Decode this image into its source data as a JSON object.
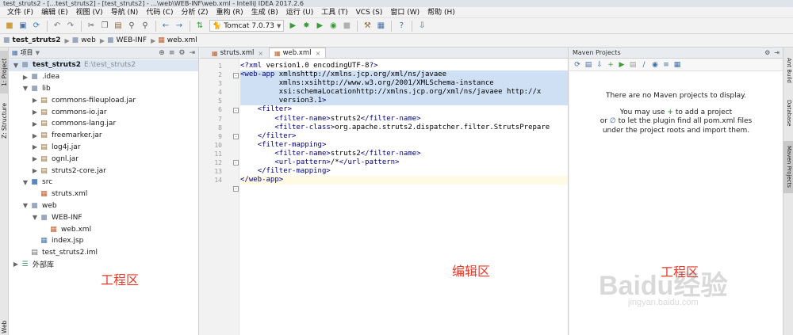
{
  "window": {
    "title": "test_struts2 - [...test_struts2] - [test_struts2] - ...\\web\\WEB-INF\\web.xml - IntelliJ IDEA 2017.2.6"
  },
  "menu": [
    "文件 (F)",
    "编辑 (E)",
    "视图 (V)",
    "导航 (N)",
    "代码 (C)",
    "分析 (Z)",
    "重构 (R)",
    "生成 (B)",
    "运行 (U)",
    "工具 (T)",
    "VCS (S)",
    "窗口 (W)",
    "帮助 (H)"
  ],
  "toolbar": {
    "run_config": "Tomcat 7.0.73"
  },
  "breadcrumb": [
    "test_struts2",
    "web",
    "WEB-INF",
    "web.xml"
  ],
  "left_strip": {
    "project_tab": "1: Project",
    "structure_tab": "Z: Structure",
    "web_tab": "Web"
  },
  "project_panel": {
    "title": "项目",
    "tree": [
      {
        "label": "test_struts2",
        "extra": "E:\\test_struts2"
      },
      {
        "label": ".idea"
      },
      {
        "label": "lib"
      },
      {
        "label": "commons-fileupload.jar"
      },
      {
        "label": "commons-io.jar"
      },
      {
        "label": "commons-lang.jar"
      },
      {
        "label": "freemarker.jar"
      },
      {
        "label": "log4j.jar"
      },
      {
        "label": "ognl.jar"
      },
      {
        "label": "struts2-core.jar"
      },
      {
        "label": "src"
      },
      {
        "label": "struts.xml"
      },
      {
        "label": "web"
      },
      {
        "label": "WEB-INF"
      },
      {
        "label": "web.xml"
      },
      {
        "label": "index.jsp"
      },
      {
        "label": "test_struts2.iml"
      },
      {
        "label": "外部库"
      }
    ]
  },
  "editor": {
    "tabs": [
      "struts.xml",
      "web.xml"
    ],
    "active_tab": "web.xml",
    "line_numbers": [
      "1",
      "2",
      "3",
      "4",
      "5",
      "6",
      "7",
      "8",
      "9",
      "10",
      "11",
      "12",
      "13",
      "14"
    ],
    "lines": [
      "<?xml version=\"1.0\" encoding=\"UTF-8\"?>",
      "<web-app xmlns=\"http://xmlns.jcp.org/xml/ns/javaee\"",
      "         xmlns:xsi=\"http://www.w3.org/2001/XMLSchema-instance\"",
      "         xsi:schemaLocation=\"http://xmlns.jcp.org/xml/ns/javaee http://x",
      "         version=\"3.1\">",
      "    <filter>",
      "        <filter-name>struts2</filter-name>",
      "        <filter-class>org.apache.struts2.dispatcher.filter.StrutsPrepare",
      "    </filter>",
      "    <filter-mapping>",
      "        <filter-name>struts2</filter-name>",
      "        <url-pattern>/*</url-pattern>",
      "    </filter-mapping>",
      "</web-app>"
    ]
  },
  "maven": {
    "title": "Maven Projects",
    "msg1": "There are no Maven projects to display.",
    "msg2_pre": "You may use",
    "msg2_post": "to add a project",
    "msg3_pre": "or",
    "msg3_post": "to let the plugin find all pom.xml files",
    "msg4": "under the project roots and import them."
  },
  "right_strip": {
    "ant": "Ant Build",
    "database": "Database",
    "maven": "Maven Projects"
  },
  "annotations": {
    "project_area": "工程区",
    "editor_area": "编辑区",
    "maven_area": "工程区"
  },
  "watermark": {
    "brand": "Baidu经验",
    "url": "jingyan.baidu.com"
  },
  "colors": {
    "annotation": "#e83a2a",
    "selection": "#cfe0f5",
    "current_line": "#fffae3"
  }
}
